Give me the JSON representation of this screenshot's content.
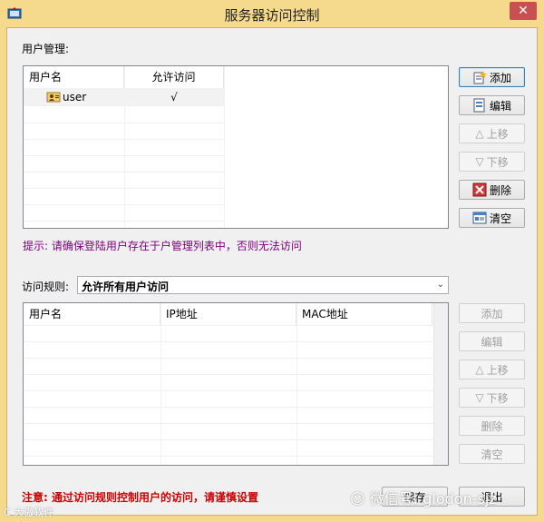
{
  "window": {
    "title": "服务器访问控制",
    "close_glyph": "✕"
  },
  "user_mgmt": {
    "label": "用户管理:",
    "columns": [
      "用户名",
      "允许访问"
    ],
    "rows": [
      {
        "name": "user",
        "allowed": "√"
      }
    ],
    "buttons": {
      "add": "添加",
      "edit": "编辑",
      "up": "上移",
      "down": "下移",
      "delete": "删除",
      "clear": "清空"
    },
    "hint": "提示: 请确保登陆用户存在于户管理列表中，否则无法访问"
  },
  "access_rules": {
    "label": "访问规则:",
    "selected": "允许所有用户访问",
    "columns": [
      "用户名",
      "IP地址",
      "MAC地址"
    ],
    "buttons": {
      "add": "添加",
      "edit": "编辑",
      "up": "上移",
      "down": "下移",
      "delete": "删除",
      "clear": "清空"
    }
  },
  "footer": {
    "warning": "注意: 通过访问规则控制用户的访问，请谨慎设置",
    "save": "保存",
    "exit": "退出"
  },
  "watermark": {
    "text": "微信号: glodon-sjz",
    "corner": "C 大傲软件"
  },
  "colors": {
    "titlebar": "#f5da8e",
    "hint": "#800080",
    "warning": "#cc0000",
    "close": "#c75050"
  }
}
